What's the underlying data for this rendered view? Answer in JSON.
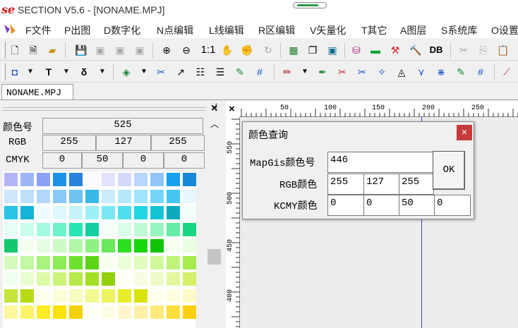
{
  "window": {
    "logo": "se",
    "title": "SECTION V5.6 - [NONAME.MPJ]"
  },
  "menu": [
    {
      "label": "F文件"
    },
    {
      "label": "P出图"
    },
    {
      "label": "D数字化"
    },
    {
      "label": "N点编辑"
    },
    {
      "label": "L线编辑"
    },
    {
      "label": "R区编辑"
    },
    {
      "label": "V矢量化"
    },
    {
      "label": "T其它"
    },
    {
      "label": "A图层"
    },
    {
      "label": "S系统库"
    },
    {
      "label": "O设置"
    }
  ],
  "toolbar1": {
    "zoom_ratio": "1:1",
    "db_label": "DB"
  },
  "toolbar2": {
    "text_tool": "T",
    "delta_tool": "δ"
  },
  "tab": {
    "label": "NONAME.MPJ"
  },
  "panel": {
    "color_no_label": "颜色号",
    "color_no_value": "525",
    "rgb_label": "RGB",
    "rgb_values": [
      "255",
      "127",
      "255"
    ],
    "cmyk_label": "CMYK",
    "cmyk_values": [
      "0",
      "50",
      "0",
      "0"
    ],
    "swatches": [
      [
        "#b4b4f8",
        "#9fb5f7",
        "#8ca0f5",
        "#1e90e8",
        "#2a82dc",
        "#fafaff",
        "#e2e2fc",
        "#d5dafc",
        "#b9d6fc",
        "#91c6f7",
        "#16a2ef",
        "#1888d8"
      ],
      [
        "#cfe6fb",
        "#bfe0fb",
        "#b4d8fb",
        "#8ac8f5",
        "#6fc3f0",
        "#39b8ea",
        "#cbecfd",
        "#b6e8fc",
        "#9fe4fb",
        "#73d6f7",
        "#44c6ef",
        "#e6f6fd"
      ],
      [
        "#29c3e4",
        "#15b3d8",
        "#f0fbff",
        "#dff8fd",
        "#c7f4fb",
        "#9ef0f7",
        "#7ae8f2",
        "#4ee0ec",
        "#22d6e4",
        "#14c4d6",
        "#0ca9be",
        "#f2fffd"
      ],
      [
        "#e6fff6",
        "#c9ffec",
        "#a3fae0",
        "#6ef2cc",
        "#26e6b2",
        "#14cfa0",
        "#f3fff7",
        "#dafde8",
        "#bffad7",
        "#98f4c1",
        "#66eca4",
        "#18d681"
      ],
      [
        "#13c86f",
        "#f4fff0",
        "#e4fde0",
        "#cdfac7",
        "#b1f7a8",
        "#8ef282",
        "#6ae85a",
        "#2ce020",
        "#18d80c",
        "#10c408",
        "#f7fff0",
        "#e9fde0"
      ],
      [
        "#d4fbbd",
        "#c1f8a0",
        "#a8f37c",
        "#8cec55",
        "#6de22c",
        "#5bd418",
        "#f8fff0",
        "#ecfed8",
        "#dffcbd",
        "#cff99b",
        "#bff37b",
        "#a6ec4e"
      ],
      [
        "#f0fff0",
        "#eafdd0",
        "#ddfaa8",
        "#ccf47a",
        "#b6ea4a",
        "#a2df24",
        "#93d00e",
        "#fdfff4",
        "#f6fde3",
        "#eefbc7",
        "#e3f79d",
        "#d5f06b"
      ],
      [
        "#c4e63c",
        "#b6db14",
        "#feffef",
        "#fcfeda",
        "#f8fcbe",
        "#f3f990",
        "#edf45e",
        "#e7ee28",
        "#dae40c",
        "#ffffee",
        "#fffde0",
        "#fffbc6"
      ],
      [
        "#fff89e",
        "#fff36a",
        "#ffec24",
        "#fbe20a",
        "#f4d208",
        "#fffff3",
        "#fffbe4",
        "#fff7cc",
        "#fff0a8",
        "#ffe87a",
        "#ffdf3e",
        "#fcd00c"
      ]
    ]
  },
  "rulers": {
    "h_labels": [
      "50",
      "100",
      "150",
      "200",
      "250"
    ],
    "v_labels": [
      "550",
      "500",
      "450",
      "400"
    ]
  },
  "dialog": {
    "title": "颜色查询",
    "mapgis_label": "MapGis颜色号",
    "mapgis_value": "446",
    "rgb_label": "RGB颜色",
    "rgb_values": [
      "255",
      "127",
      "255"
    ],
    "kcmy_label": "KCMY颜色",
    "kcmy_values": [
      "0",
      "0",
      "50",
      "0"
    ],
    "ok_label": "OK",
    "close_glyph": "×"
  },
  "colors": {
    "logo_red": "#d21a1a",
    "dialog_close_red": "#c53a3a",
    "guide_blue": "#3c3ce6"
  }
}
